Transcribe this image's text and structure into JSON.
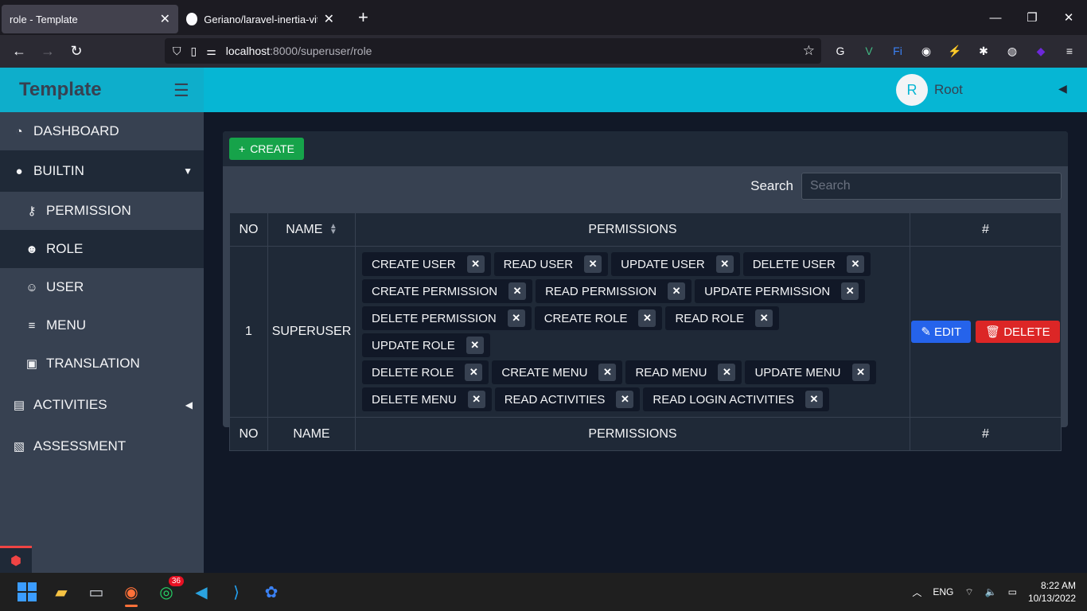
{
  "browser": {
    "active_tab": "role - Template",
    "inactive_tab": "Geriano/laravel-inertia-vite-tem",
    "url_host": "localhost",
    "url_path": ":8000/superuser/role"
  },
  "app": {
    "brand": "Template",
    "avatar_letter": "R",
    "username": "Root"
  },
  "sidebar": {
    "items": [
      {
        "label": "DASHBOARD",
        "icon": "dashboard-icon"
      },
      {
        "label": "BUILTIN",
        "icon": "circle-icon"
      },
      {
        "label": "PERMISSION",
        "icon": "key-icon"
      },
      {
        "label": "ROLE",
        "icon": "user-gear-icon"
      },
      {
        "label": "USER",
        "icon": "user-icon"
      },
      {
        "label": "MENU",
        "icon": "bars-icon"
      },
      {
        "label": "TRANSLATION",
        "icon": "language-icon"
      },
      {
        "label": "ACTIVITIES",
        "icon": "id-card-icon"
      },
      {
        "label": "ASSESSMENT",
        "icon": "file-gear-icon"
      }
    ]
  },
  "toolbar": {
    "create_label": "CREATE",
    "search_label": "Search",
    "search_placeholder": "Search"
  },
  "table": {
    "headers": [
      "NO",
      "NAME",
      "PERMISSIONS",
      "#"
    ],
    "rows": [
      {
        "no": "1",
        "name": "SUPERUSER",
        "permissions": [
          "CREATE USER",
          "READ USER",
          "UPDATE USER",
          "DELETE USER",
          "CREATE PERMISSION",
          "READ PERMISSION",
          "UPDATE PERMISSION",
          "DELETE PERMISSION",
          "CREATE ROLE",
          "READ ROLE",
          "UPDATE ROLE",
          "DELETE ROLE",
          "CREATE MENU",
          "READ MENU",
          "UPDATE MENU",
          "DELETE MENU",
          "READ ACTIVITIES",
          "READ LOGIN ACTIVITIES"
        ],
        "edit_label": "EDIT",
        "delete_label": "DELETE"
      }
    ]
  },
  "taskbar": {
    "whatsapp_badge": "36",
    "language": "ENG",
    "time": "8:22 AM",
    "date": "10/13/2022"
  },
  "colors": {
    "header": "#06b6d4",
    "create": "#16a34a",
    "edit": "#2563eb",
    "delete": "#dc2626"
  }
}
